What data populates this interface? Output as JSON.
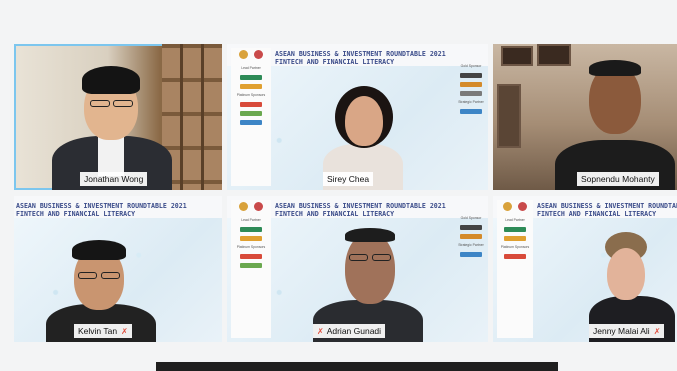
{
  "banner": {
    "title_line1": "ASEAN BUSINESS & INVESTMENT ROUNDTABLE 2021",
    "title_line2": "FINTECH AND FINANCIAL LITERACY",
    "partner_label": "Lead Partner",
    "partner_label2": "Platinum Sponsors",
    "strategic_label": "Strategic Partner",
    "sponsor_label": "Gold Sponsor"
  },
  "participants": [
    {
      "name": "Jonathan Wong",
      "active": true,
      "muted": false
    },
    {
      "name": "Sirey Chea",
      "active": false,
      "muted": false
    },
    {
      "name": "Sopnendu Mohanty",
      "active": false,
      "muted": false
    },
    {
      "name": "Kelvin Tan",
      "active": false,
      "muted": true
    },
    {
      "name": "Adrian Gunadi",
      "active": false,
      "muted": true
    },
    {
      "name": "Jenny Malai Ali",
      "active": false,
      "muted": true
    }
  ],
  "colors": {
    "active_border": "#7cc6ee",
    "muted_icon": "#e14b3b",
    "banner_title": "#3b4c8a"
  },
  "icons": {
    "muted": "mic-muted-icon",
    "name_prefix": "mic-icon"
  }
}
